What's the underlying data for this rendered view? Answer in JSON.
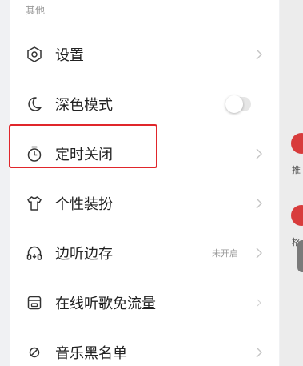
{
  "section": {
    "title": "其他"
  },
  "rows": [
    {
      "label": "设置",
      "icon": "settings-hexagon-icon"
    },
    {
      "label": "深色模式",
      "icon": "moon-icon",
      "toggle_on": false
    },
    {
      "label": "定时关闭",
      "icon": "stopwatch-icon"
    },
    {
      "label": "个性装扮",
      "icon": "tshirt-icon"
    },
    {
      "label": "边听边存",
      "icon": "headphones-icon",
      "status": "未开启"
    },
    {
      "label": "在线听歌免流量",
      "icon": "sim-card-icon"
    },
    {
      "label": "音乐黑名单",
      "icon": "block-icon"
    }
  ],
  "colors": {
    "highlight": "#e0262b",
    "accent_dot": "#d83c3c"
  },
  "background": {
    "peek_texts": [
      "推",
      "格"
    ]
  }
}
